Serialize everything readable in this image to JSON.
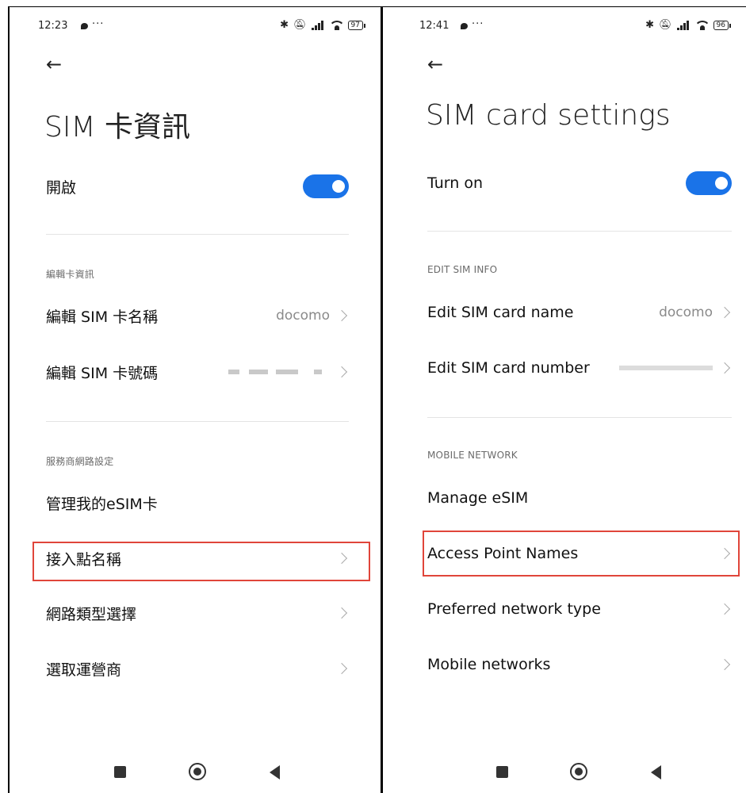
{
  "left": {
    "status": {
      "time": "12:23",
      "battery": "97"
    },
    "title": "SIM 卡資訊",
    "toggle_label": "開啟",
    "section1": "編輯卡資訊",
    "edit_name_label": "編輯 SIM 卡名稱",
    "edit_name_value": "docomo",
    "edit_number_label": "編輯 SIM 卡號碼",
    "section2": "服務商網路設定",
    "manage_esim": "管理我的eSIM卡",
    "apn": "接入點名稱",
    "network_type": "網路類型選擇",
    "operator": "選取運營商"
  },
  "right": {
    "status": {
      "time": "12:41",
      "battery": "96"
    },
    "title": "SIM card settings",
    "toggle_label": "Turn on",
    "section1": "EDIT SIM INFO",
    "edit_name_label": "Edit SIM card name",
    "edit_name_value": "docomo",
    "edit_number_label": "Edit SIM card number",
    "section2": "MOBILE NETWORK",
    "manage_esim": "Manage eSIM",
    "apn": "Access Point Names",
    "network_type": "Preferred network type",
    "mobile_networks": "Mobile networks"
  },
  "accent": "#1a73e8",
  "highlight_color": "#e0453a"
}
